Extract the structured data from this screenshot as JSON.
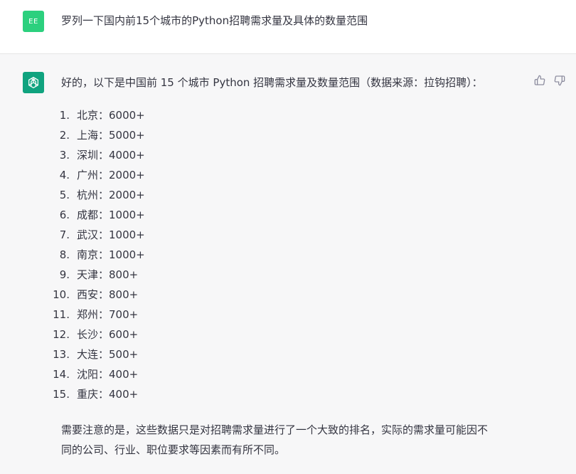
{
  "user_message": {
    "avatar_initials": "EE",
    "text": "罗列一下国内前15个城市的Python招聘需求量及具体的数量范围"
  },
  "assistant_message": {
    "intro": "好的，以下是中国前 15 个城市 Python 招聘需求量及数量范围（数据来源：拉钩招聘）：",
    "items": [
      {
        "num": "1.",
        "text": "北京：6000+"
      },
      {
        "num": "2.",
        "text": "上海：5000+"
      },
      {
        "num": "3.",
        "text": "深圳：4000+"
      },
      {
        "num": "4.",
        "text": "广州：2000+"
      },
      {
        "num": "5.",
        "text": "杭州：2000+"
      },
      {
        "num": "6.",
        "text": "成都：1000+"
      },
      {
        "num": "7.",
        "text": "武汉：1000+"
      },
      {
        "num": "8.",
        "text": "南京：1000+"
      },
      {
        "num": "9.",
        "text": "天津：800+"
      },
      {
        "num": "10.",
        "text": "西安：800+"
      },
      {
        "num": "11.",
        "text": "郑州：700+"
      },
      {
        "num": "12.",
        "text": "长沙：600+"
      },
      {
        "num": "13.",
        "text": "大连：500+"
      },
      {
        "num": "14.",
        "text": "沈阳：400+"
      },
      {
        "num": "15.",
        "text": "重庆：400+"
      }
    ],
    "note_line1": "需要注意的是，这些数据只是对招聘需求量进行了一个大致的排名，实际的需求量可能因不",
    "note_line2": "同的公司、行业、职位要求等因素而有所不同。"
  },
  "icons": {
    "thumb_up": "thumbs-up-icon",
    "thumb_down": "thumbs-down-icon",
    "logo": "openai-logo-icon"
  },
  "colors": {
    "user_avatar": "#2cd07e",
    "gpt_avatar": "#10a37f",
    "assistant_bg": "#f7f7f8"
  }
}
